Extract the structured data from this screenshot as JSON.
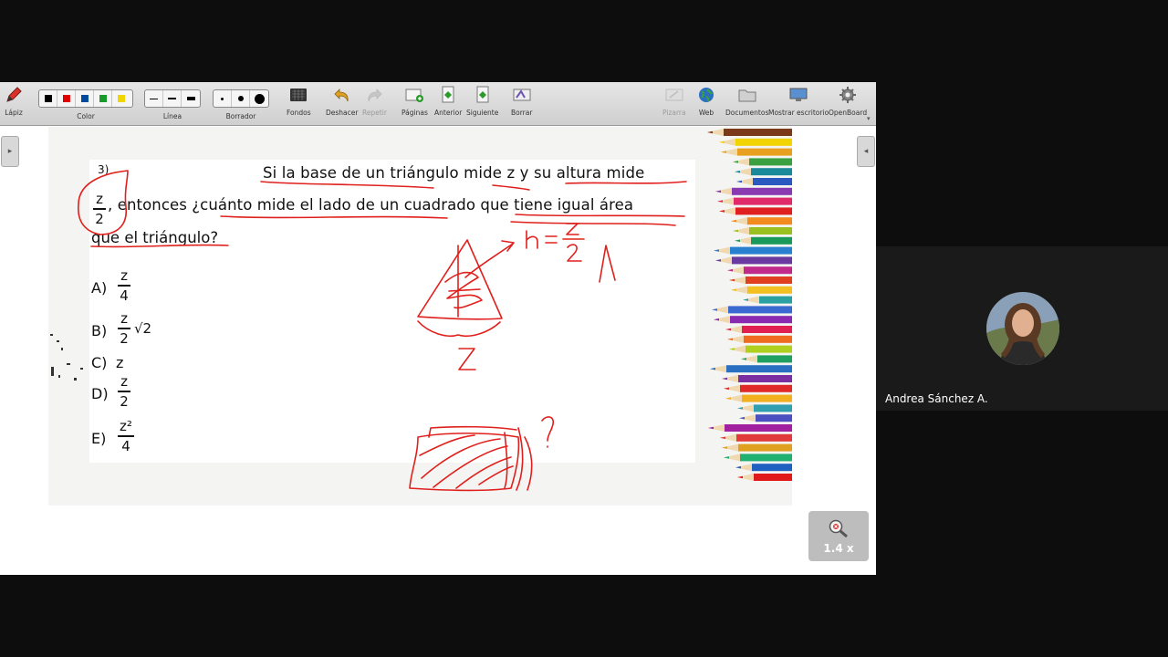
{
  "toolbar": {
    "pen": "Lápiz",
    "color": "Color",
    "line": "Línea",
    "eraser": "Borrador",
    "backgrounds": "Fondos",
    "undo": "Deshacer",
    "redo": "Repetir",
    "pages": "Páginas",
    "previous": "Anterior",
    "next": "Siguiente",
    "clear": "Borrar",
    "board": "Pizarra",
    "web": "Web",
    "documents": "Documentos",
    "desktop": "Mostrar escritorio",
    "openboard": "OpenBoard",
    "colors": [
      "#000000",
      "#e00000",
      "#004a9c",
      "#1a9a2a",
      "#f2d400"
    ]
  },
  "question": {
    "number": "3)",
    "line1": "Si la base de un triángulo mide z y su altura mide",
    "line2": ", entonces ¿cuánto mide el lado de un cuadrado que tiene igual área",
    "line3": "que el triángulo?",
    "frac_num": "z",
    "frac_den": "2"
  },
  "options": [
    {
      "label": "A)",
      "num": "z",
      "den": "4",
      "extra": ""
    },
    {
      "label": "B)",
      "num": "z",
      "den": "2",
      "extra": "√2"
    },
    {
      "label": "C)",
      "text": "z"
    },
    {
      "label": "D)",
      "num": "z",
      "den": "2",
      "extra": ""
    },
    {
      "label": "E)",
      "num": "z²",
      "den": "4",
      "extra": ""
    }
  ],
  "annotations": {
    "h_eq": "h =",
    "h_num": "z",
    "h_den": "2",
    "base": "z",
    "qmark": "?"
  },
  "zoom": "1.4 x",
  "participant": {
    "name": "Andrea Sánchez A."
  },
  "ink_color": "#e0201c"
}
